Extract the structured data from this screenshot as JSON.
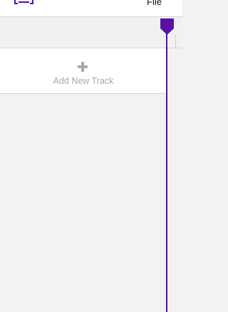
{
  "colors": {
    "accent": "#5b10a6",
    "background": "#f2f2f2",
    "panel": "#ffffff",
    "muted_text": "#a7a7a7"
  },
  "header": {
    "logo_icon": "bracket-logo-icon",
    "file_menu_label": "File"
  },
  "tracks": {
    "add_icon": "plus-icon",
    "add_label": "Add New Track"
  },
  "timeline": {
    "playhead_icon": "playhead-marker-icon"
  }
}
